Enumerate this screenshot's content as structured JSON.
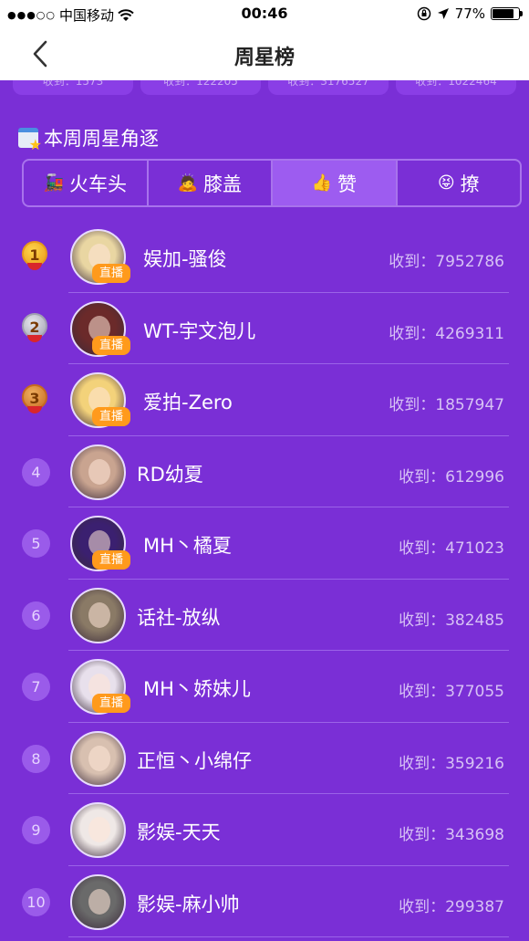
{
  "status_bar": {
    "carrier": "中国移动",
    "signal_dots": "●●●○○",
    "time": "00:46",
    "battery": "77%",
    "battery_level": 0.77
  },
  "nav": {
    "title": "周星榜"
  },
  "top_cards": [
    "收到：1573",
    "收到：122205",
    "收到：3176527",
    "收到：1022464"
  ],
  "section": {
    "title": "本周周星角逐"
  },
  "tabs": [
    {
      "label": "火车头",
      "icon": "train-icon"
    },
    {
      "label": "膝盖",
      "icon": "kneel-icon"
    },
    {
      "label": "赞",
      "icon": "thumb-icon",
      "active": true
    },
    {
      "label": "撩",
      "icon": "tease-icon"
    }
  ],
  "received_label": "收到：",
  "live_label": "直播",
  "ranking": [
    {
      "rank": "1",
      "name": "娱加-骚俊",
      "received": "7952786",
      "live": true,
      "medal": "gold",
      "avatar_color": "#e9d6a2"
    },
    {
      "rank": "2",
      "name": "WT-宇文泡儿",
      "received": "4269311",
      "live": true,
      "medal": "silver",
      "avatar_color": "#6b2a2a"
    },
    {
      "rank": "3",
      "name": "爱拍-Zero",
      "received": "1857947",
      "live": true,
      "medal": "bronze",
      "avatar_color": "#f3d27a"
    },
    {
      "rank": "4",
      "name": "RD幼夏",
      "received": "612996",
      "live": false,
      "avatar_color": "#c9a490"
    },
    {
      "rank": "5",
      "name": "MH丶橘夏",
      "received": "471023",
      "live": true,
      "avatar_color": "#3b2070"
    },
    {
      "rank": "6",
      "name": "话社-放纵",
      "received": "382485",
      "live": false,
      "avatar_color": "#8a7a66"
    },
    {
      "rank": "7",
      "name": "MH丶娇妹儿",
      "received": "377055",
      "live": true,
      "avatar_color": "#e8e0ec"
    },
    {
      "rank": "8",
      "name": "正恒丶小绵仔",
      "received": "359216",
      "live": false,
      "avatar_color": "#d8c0b0"
    },
    {
      "rank": "9",
      "name": "影娱-天天",
      "received": "343698",
      "live": false,
      "avatar_color": "#efe8e6"
    },
    {
      "rank": "10",
      "name": "影娱-麻小帅",
      "received": "299387",
      "live": false,
      "avatar_color": "#6a6a6a"
    }
  ]
}
